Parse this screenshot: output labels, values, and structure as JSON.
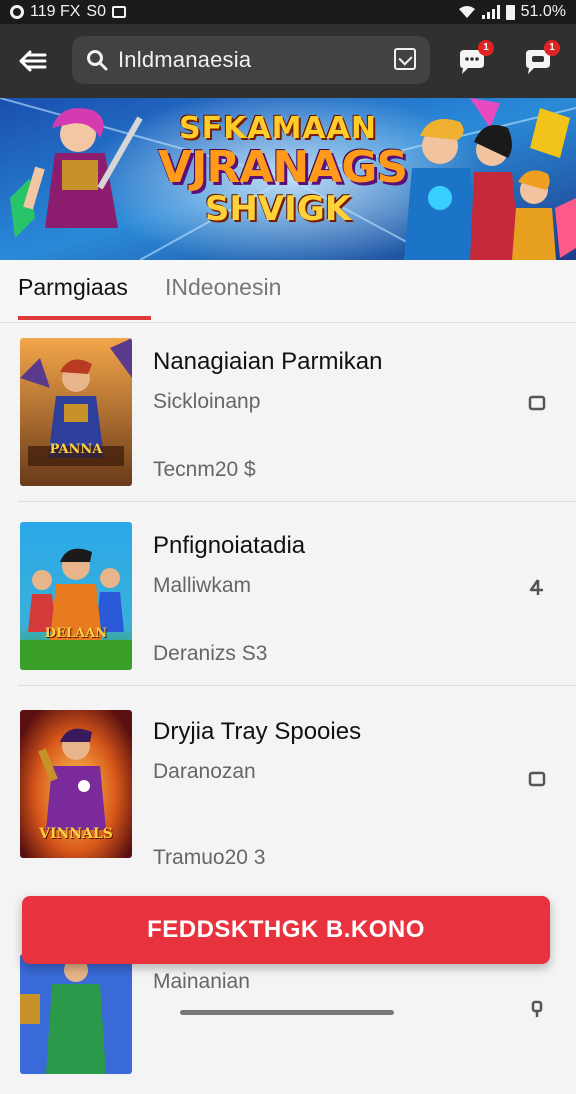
{
  "status_bar": {
    "time": "119 FX",
    "notification_text": "S0",
    "battery": "51.0%"
  },
  "topbar": {
    "search_text": "Inldmanaesia",
    "notification_badge": "1",
    "message_badge": "1"
  },
  "banner": {
    "line1": "SFKAMAAN",
    "line2": "VJRANAGS",
    "line3": "SHVIGK"
  },
  "tabs": [
    {
      "label": "Parmgiaas"
    },
    {
      "label": "INdeonesin"
    }
  ],
  "items": [
    {
      "title": "Nanagiaian Parmikan",
      "subtitle": "Sickloinanp",
      "price": "Tecnm20 $",
      "art_label": "PANNA"
    },
    {
      "title": "Pnfignoiatadia",
      "subtitle": "Malliwkam",
      "price": "Deranizs S3",
      "art_label": "DELAAN"
    },
    {
      "title": "Dryjia Tray Spooies",
      "subtitle": "Daranozan",
      "price": "Tramuo20 3",
      "art_label": "VINNALS"
    },
    {
      "title": "",
      "subtitle": "Mainanian",
      "price": "",
      "art_label": ""
    }
  ],
  "cta": {
    "label": "FEDDSKTHGK B.KONO",
    "color": "#e8333f"
  },
  "colors": {
    "accent": "#e03a3a",
    "topbar": "#303030",
    "statusbar": "#1b1b1b"
  }
}
